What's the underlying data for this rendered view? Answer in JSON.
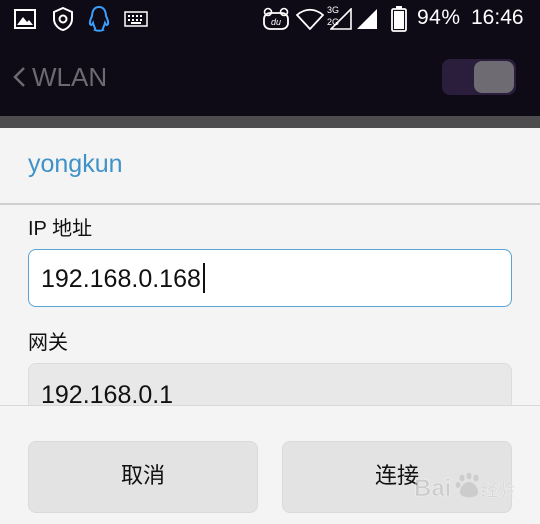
{
  "status_bar": {
    "battery_percent": "94%",
    "time": "16:46",
    "network_labels": [
      "3G",
      "2G"
    ],
    "icons": [
      "gallery-icon",
      "shield-icon",
      "qq-icon",
      "keyboard-icon",
      "du-icon",
      "wifi-icon",
      "signal-icon",
      "signal-icon",
      "battery-icon"
    ]
  },
  "action_bar": {
    "title": "WLAN",
    "toggle_on": true
  },
  "dialog": {
    "title": "yongkun",
    "ip_label": "IP 地址",
    "ip_value": "192.168.0.168",
    "gateway_label": "网关",
    "gateway_value": "192.168.0.1",
    "cancel_label": "取消",
    "connect_label": "连接"
  },
  "watermark": {
    "text_latin": "Bai",
    "text_cn": "经验"
  },
  "colors": {
    "accent": "#3f92c8",
    "status_bg": "#0e0a16",
    "dialog_bg": "#f4f4f4"
  }
}
